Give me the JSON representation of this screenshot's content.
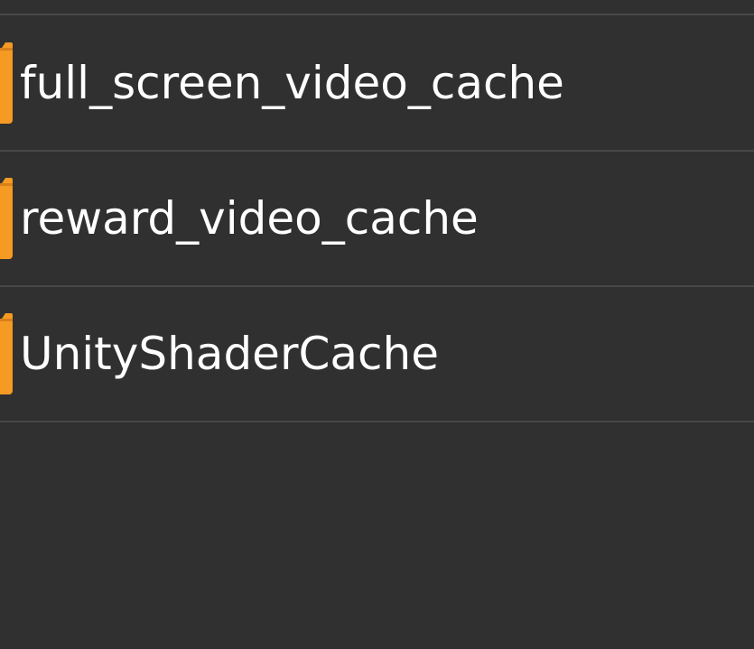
{
  "files": {
    "items": [
      {
        "label": "full_screen_video_cache",
        "type": "folder",
        "icon": "folder-icon"
      },
      {
        "label": "reward_video_cache",
        "type": "folder",
        "icon": "folder-icon"
      },
      {
        "label": "UnityShaderCache",
        "type": "folder",
        "icon": "folder-icon"
      }
    ]
  },
  "colors": {
    "background": "#303030",
    "divider": "#474747",
    "folder": "#f59a23",
    "text": "#ffffff"
  }
}
